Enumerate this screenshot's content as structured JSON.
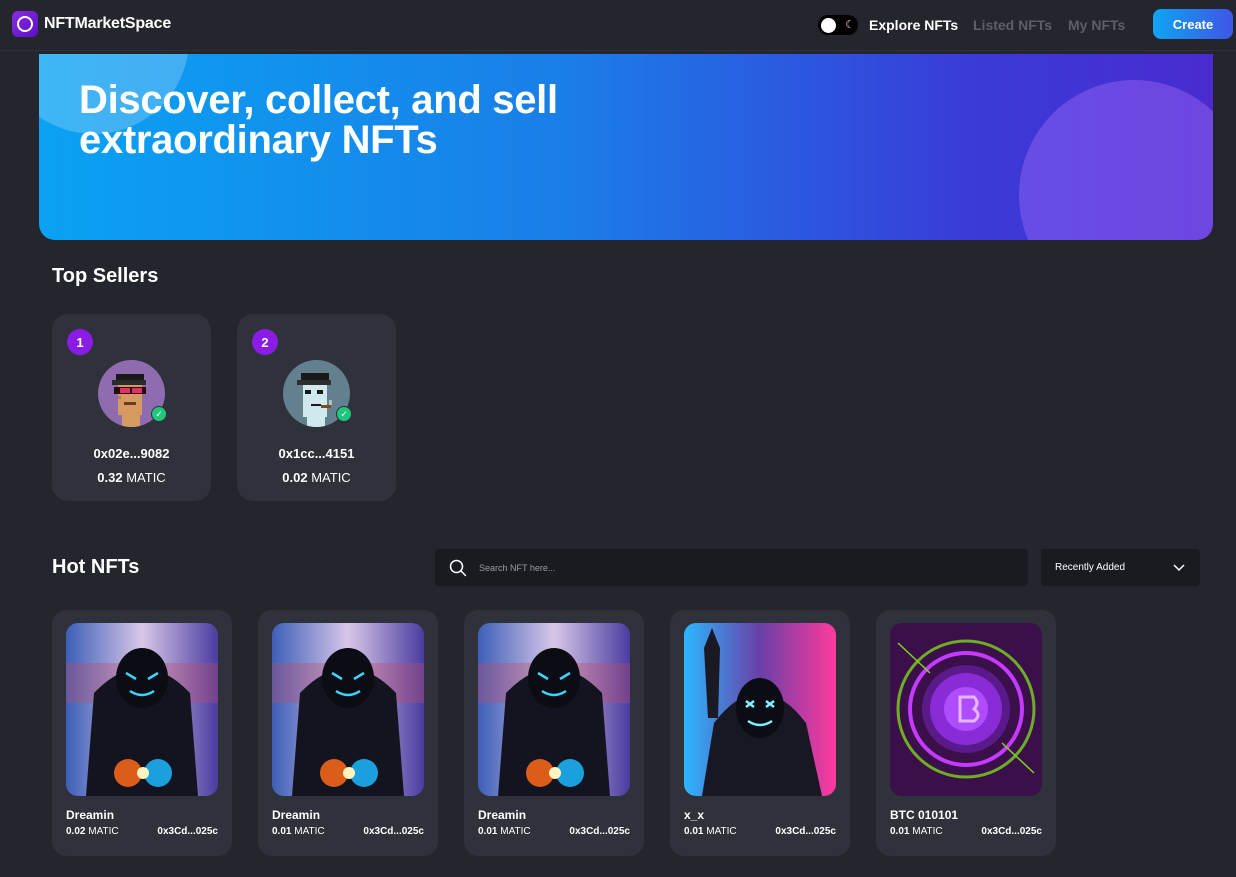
{
  "brand": {
    "name": "NFTMarketSpace"
  },
  "nav": {
    "links": [
      {
        "label": "Explore NFTs"
      },
      {
        "label": "Listed NFTs"
      },
      {
        "label": "My NFTs"
      }
    ],
    "create_label": "Create"
  },
  "hero": {
    "title_line1": "Discover, collect, and sell",
    "title_line2": "extraordinary NFTs"
  },
  "sellers": {
    "title": "Top Sellers",
    "items": [
      {
        "rank": "1",
        "address": "0x02e...9082",
        "amount": "0.32",
        "unit": "MATIC"
      },
      {
        "rank": "2",
        "address": "0x1cc...4151",
        "amount": "0.02",
        "unit": "MATIC"
      }
    ]
  },
  "hot": {
    "title": "Hot NFTs",
    "search_placeholder": "Search NFT here...",
    "filter_label": "Recently Added",
    "items": [
      {
        "name": "Dreamin",
        "price": "0.02",
        "unit": "MATIC",
        "owner": "0x3Cd...025c"
      },
      {
        "name": "Dreamin",
        "price": "0.01",
        "unit": "MATIC",
        "owner": "0x3Cd...025c"
      },
      {
        "name": "Dreamin",
        "price": "0.01",
        "unit": "MATIC",
        "owner": "0x3Cd...025c"
      },
      {
        "name": "x_x",
        "price": "0.01",
        "unit": "MATIC",
        "owner": "0x3Cd...025c"
      },
      {
        "name": "BTC 010101",
        "price": "0.01",
        "unit": "MATIC",
        "owner": "0x3Cd...025c"
      }
    ]
  },
  "colors": {
    "background": "#24252d",
    "card": "#2f313b",
    "accent_purple": "#8a1ce6",
    "accent_blue": "#0fa5f2"
  }
}
